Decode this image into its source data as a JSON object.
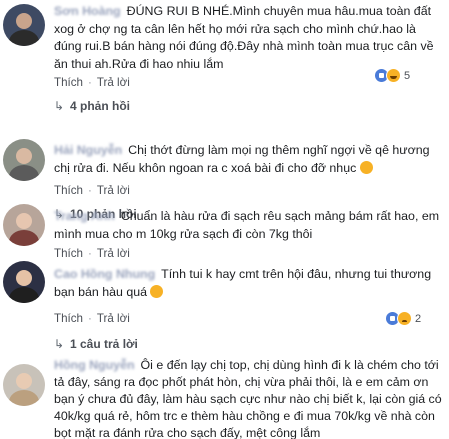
{
  "actions": {
    "like": "Thích",
    "reply": "Trả lời",
    "sep": "·"
  },
  "comments": [
    {
      "author": "Sơn Hoàng",
      "text": "ĐÚNG RUI B NHÉ.Mình chuyên mua hâu.mua toàn đất xog ở chợ ng ta cân lên hết họ mới rửa sạch cho mình chứ.hao là đúng rui.B bán hàng nói đúng độ.Đây nhà mình toàn mua trục cân về ăn thui ah.Rửa đi hao nhiu lắm",
      "reactions": "5",
      "replies": "4 phản hồi"
    },
    {
      "author": "Hải Nguyễn",
      "text": "Chị thớt đừng làm mọi ng thêm nghĩ ngợi về qê hương chị rửa đi. Nếu khôn ngoan ra c xoá bài đi cho đỡ nhục",
      "reactions": "",
      "replies": "10 phản hồi"
    },
    {
      "author": "Trang Anh",
      "text": "Chuẩn là hàu rửa đi sạch rêu sạch mảng bám rất hao, em mình mua cho m 10kg rửa sạch đi còn 7kg thôi",
      "reactions": "",
      "replies": ""
    },
    {
      "author": "Cao Hồng Nhung",
      "text": "Tính tui k hay cmt trên hội đâu, nhưng tui thương bạn bán hàu quá",
      "reactions": "2",
      "replies": "1 câu trả lời"
    },
    {
      "author": "Hồng Nguyễn",
      "text": "Ôi e đến lạy chị top, chị dùng hình đi k là chém cho tới tả đây, sáng ra đọc phốt phát hòn, chị vừa phải thôi, là e em cảm ơn bạn ý chưa đủ đây, làm hàu sạch cực như nào chị biết k, lại còn giá có 40k/kg quá rẻ, hôm trc e thèm hàu chồng e đi mua 70k/kg về nhà còn bọt mặt ra đánh rửa cho sạch đấy, mệt công lắm",
      "reactions": "",
      "replies": ""
    }
  ],
  "colors": {
    "link": "#4b4f56",
    "like": "#4a7bd8",
    "haha": "#f7b125"
  },
  "icons": [
    "like-icon",
    "haha-icon",
    "sad-icon",
    "reply-arrow-icon"
  ]
}
